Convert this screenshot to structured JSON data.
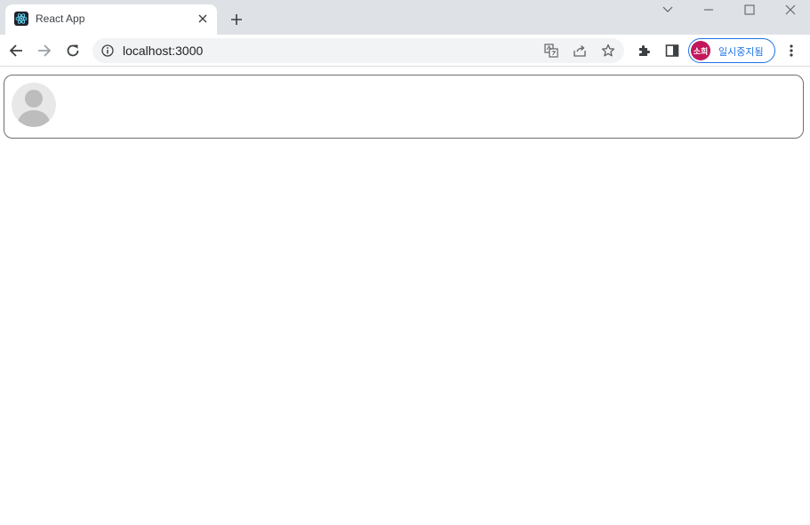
{
  "browser": {
    "tab": {
      "title": "React App",
      "favicon": "react-logo-icon"
    },
    "address_bar": {
      "url": "localhost:3000"
    },
    "profile": {
      "avatar_text": "소희",
      "status_label": "일시중지됨",
      "color": "#c2185b"
    }
  },
  "page": {
    "card": {
      "avatar": "default-user-avatar"
    }
  }
}
